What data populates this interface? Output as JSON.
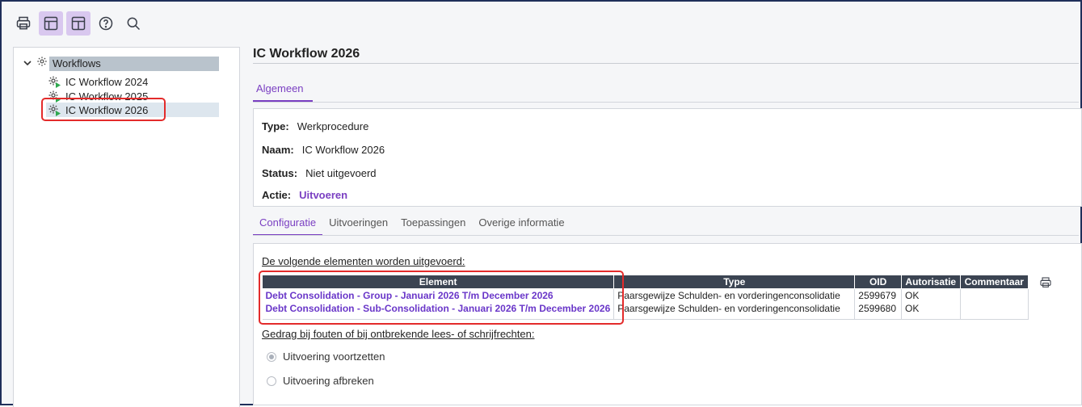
{
  "toolbar": {
    "icons": [
      "print-icon",
      "layout-icon",
      "layout-split-icon",
      "help-icon",
      "search-icon"
    ]
  },
  "tree": {
    "root_label": "Workflows",
    "items": [
      {
        "label": "IC Workflow 2024"
      },
      {
        "label": "IC Workflow 2025"
      },
      {
        "label": "IC Workflow 2026",
        "selected": true
      }
    ]
  },
  "main": {
    "title": "IC Workflow 2026",
    "top_tab": "Algemeen",
    "info": {
      "type_label": "Type:",
      "type_value": "Werkprocedure",
      "naam_label": "Naam:",
      "naam_value": "IC Workflow 2026",
      "status_label": "Status:",
      "status_value": "Niet uitgevoerd",
      "actie_label": "Actie:",
      "actie_value": "Uitvoeren"
    },
    "sub_tabs": [
      "Configuratie",
      "Uitvoeringen",
      "Toepassingen",
      "Overige informatie"
    ],
    "active_sub_tab": "Configuratie",
    "config": {
      "heading": "De volgende elementen worden uitgevoerd:",
      "columns": [
        "Element",
        "Type",
        "OID",
        "Autorisatie",
        "Commentaar"
      ],
      "rows": [
        {
          "element": "Debt Consolidation - Group - Januari 2026 T/m December 2026",
          "type": "Paarsgewijze Schulden- en vorderingenconsolidatie",
          "oid": "2599679",
          "autorisatie": "OK",
          "commentaar": ""
        },
        {
          "element": "Debt Consolidation - Sub-Consolidation - Januari 2026 T/m December 2026",
          "type": "Paarsgewijze Schulden- en vorderingenconsolidatie",
          "oid": "2599680",
          "autorisatie": "OK",
          "commentaar": ""
        }
      ],
      "error_heading": "Gedrag bij fouten of bij ontbrekende lees- of schrijfrechten:",
      "options": [
        {
          "label": "Uitvoering voortzetten",
          "checked": true
        },
        {
          "label": "Uitvoering afbreken",
          "checked": false
        }
      ]
    }
  },
  "colors": {
    "accent": "#7a3fc2",
    "table_header": "#3b4452",
    "highlight": "#e32b2b",
    "active_toolbar": "#d9c8ef",
    "frame": "#1f2f5a"
  }
}
